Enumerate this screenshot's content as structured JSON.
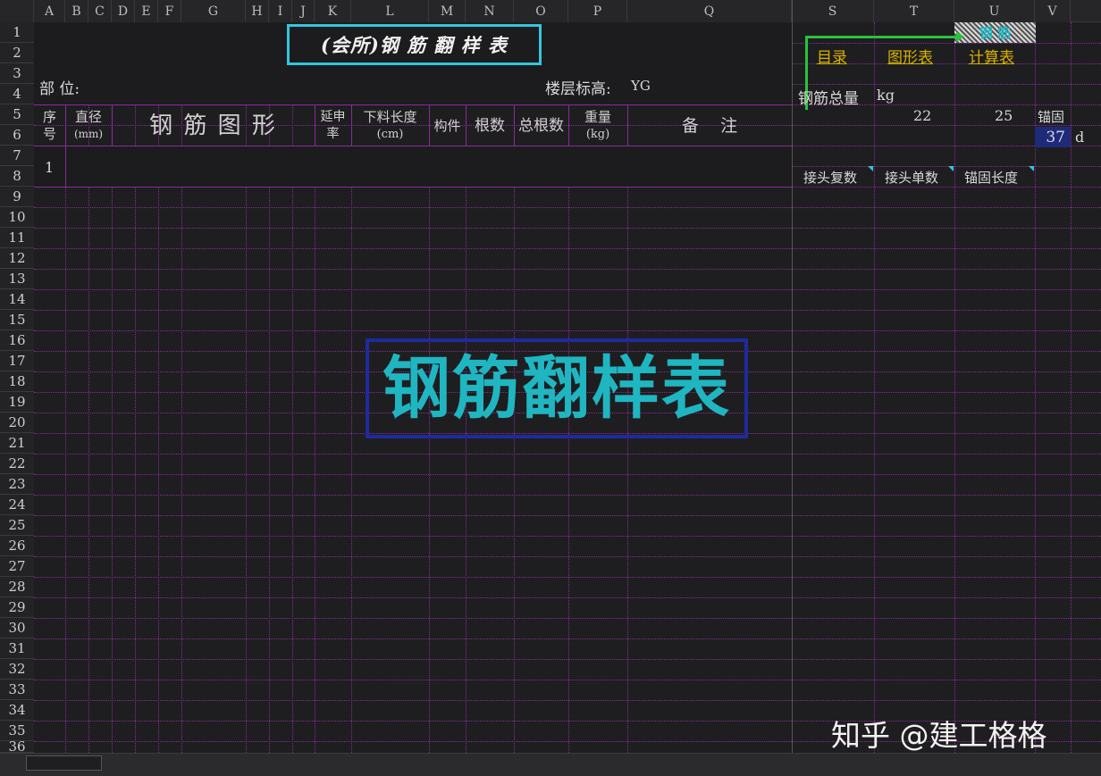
{
  "columns": [
    "A",
    "B",
    "C",
    "D",
    "E",
    "F",
    "G",
    "H",
    "I",
    "J",
    "K",
    "L",
    "M",
    "N",
    "O",
    "P",
    "Q",
    "S",
    "T",
    "U",
    "V"
  ],
  "rows": [
    "1",
    "2",
    "3",
    "4",
    "5",
    "6",
    "7",
    "8",
    "9",
    "10",
    "11",
    "12",
    "13",
    "14",
    "15",
    "16",
    "17",
    "18",
    "19",
    "20",
    "21",
    "22",
    "23",
    "24",
    "25",
    "26",
    "27",
    "28",
    "29",
    "30",
    "31",
    "32",
    "33",
    "34",
    "35",
    "36"
  ],
  "title": "(会所)钢 筋 翻 样 表",
  "location_label": "部 位:",
  "floor_height_label": "楼层标高:",
  "floor_height_value": "YG",
  "table_headers": {
    "seq": [
      "序",
      "号"
    ],
    "diameter": [
      "直径",
      "(mm)"
    ],
    "shape": "钢 筋 图 形",
    "elongation": [
      "延申",
      "率"
    ],
    "cut_length": [
      "下料长度",
      "(cm)"
    ],
    "member": "构件",
    "count": "根数",
    "total_count": "总根数",
    "weight": [
      "重量",
      "(kg)"
    ],
    "remarks": "备    注"
  },
  "row_seq_1": "1",
  "nav_links": {
    "contents": "目录",
    "shape_table": "图形表",
    "calc_table": "计算表"
  },
  "top_right_cell": "钢 筋",
  "steel_total_label": "钢筋总量",
  "steel_total_unit": "kg",
  "num_22": "22",
  "num_25": "25",
  "anchor_label": "锚固",
  "anchor_value": "37",
  "anchor_unit": "d",
  "side_headers": [
    "接头复数",
    "接头单数",
    "锚固长度"
  ],
  "banner": "钢筋翻样表",
  "watermark": "知乎 @建工格格",
  "colors": {
    "accent_teal": "#1fb6c1",
    "grid_purple": "#8a2a9a",
    "link_gold": "#d8b200",
    "banner_border": "#1f2a9e"
  }
}
